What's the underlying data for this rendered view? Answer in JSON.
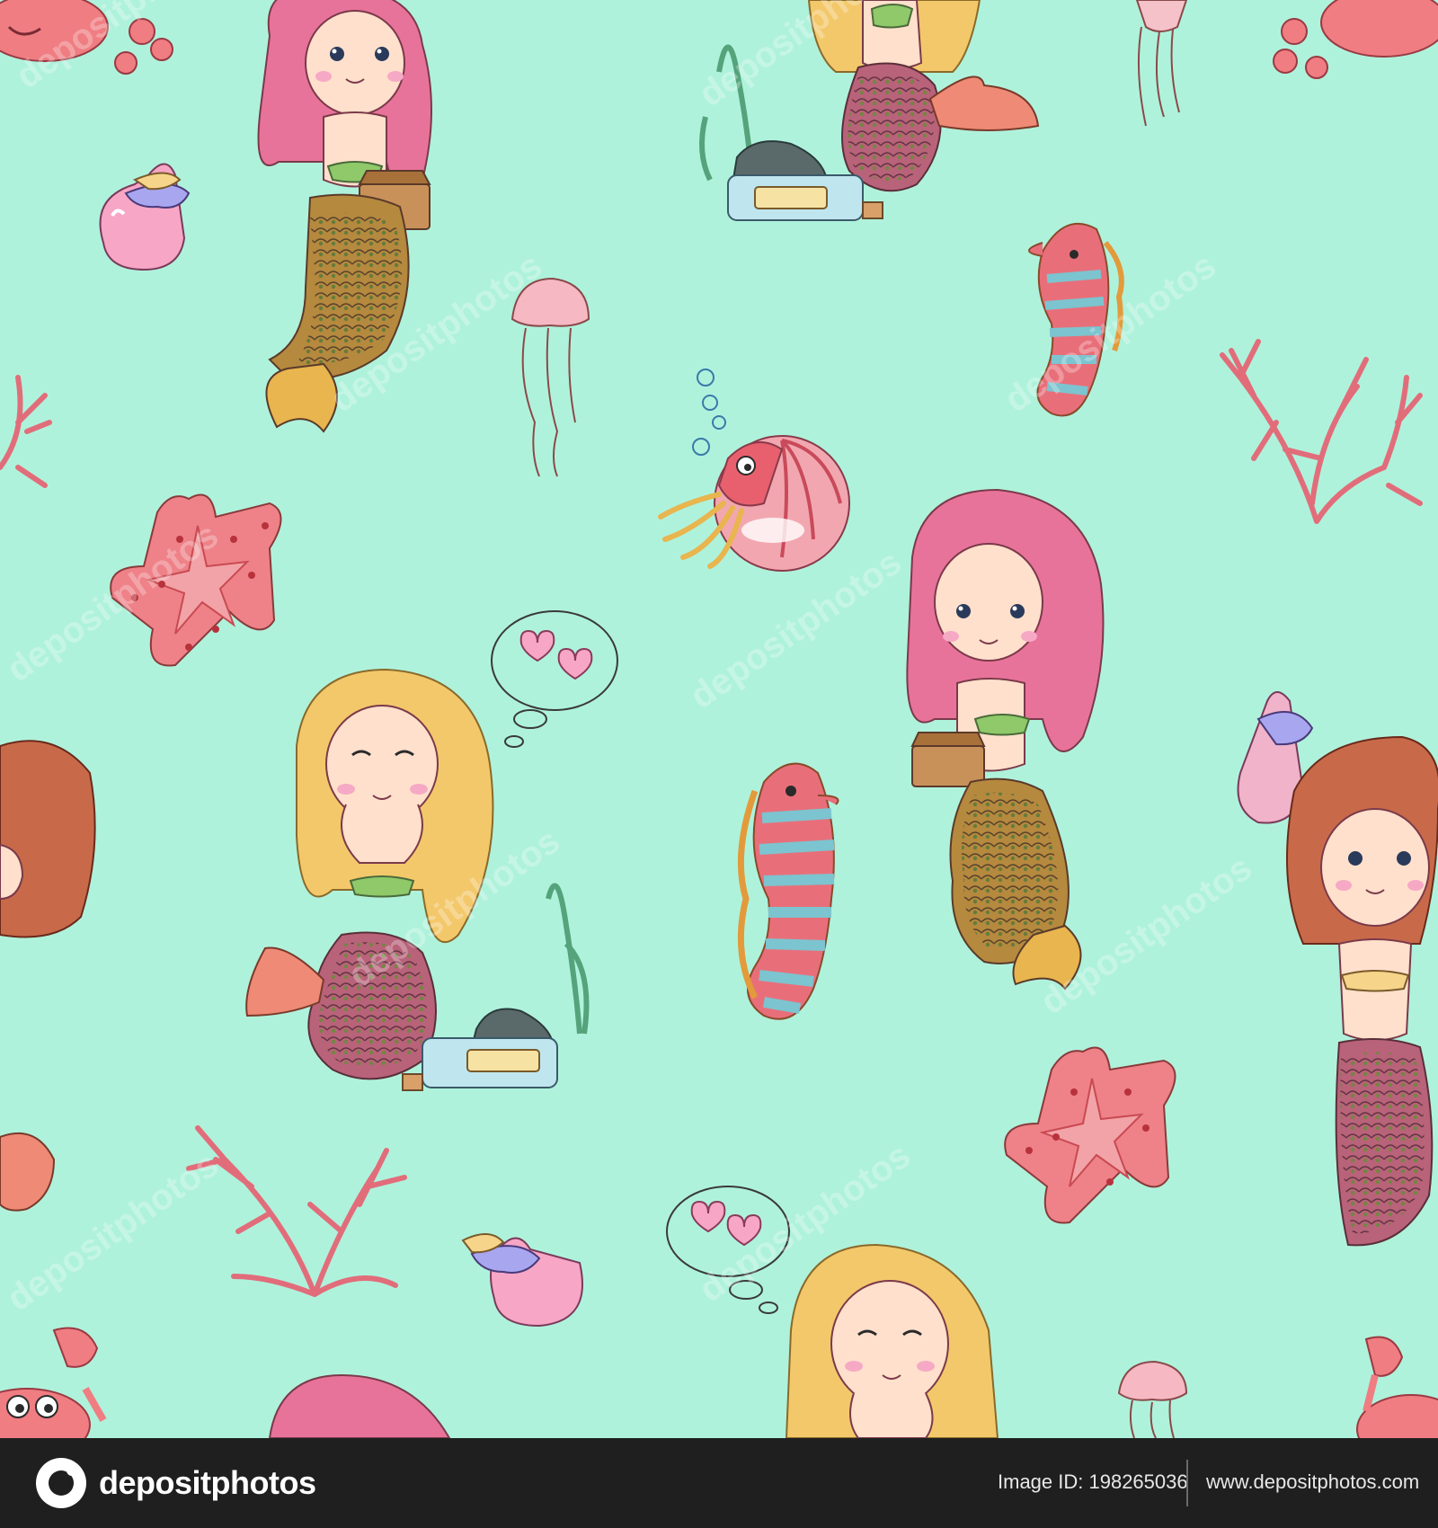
{
  "palette": {
    "background": "#aff2dc",
    "footer": "#1f1f1f",
    "hair_pink": "#e8739a",
    "hair_blonde": "#f3c86b",
    "hair_auburn": "#c86a4a",
    "tail_brown": "#b5893e",
    "tail_pink": "#b8637a",
    "coral": "#e26d7a",
    "starfish": "#e9777f",
    "seahorse_stripe_a": "#e86f7a",
    "seahorse_stripe_b": "#7cc4cf",
    "seaweed": "#55a37b"
  },
  "pattern": {
    "watermark_text": "depositphotos",
    "items": [
      "mermaid-pink-hair-chest",
      "mermaid-blonde-hearts",
      "mermaid-pink-hair-chest-right",
      "mermaid-auburn-shell",
      "mermaid-blonde-top",
      "mermaid-blonde-bottom",
      "seahorse",
      "seahorse-small",
      "starfish",
      "starfish-right",
      "jellyfish",
      "jellyfish-small",
      "jellyfish-top",
      "coral",
      "coral-right",
      "coral-left",
      "seashell",
      "seashell-bottom",
      "nautilus",
      "bottle-message",
      "bottle-message-top",
      "crab",
      "crab-bottom",
      "heart-bubble",
      "heart-bubble-bottom"
    ]
  },
  "footer": {
    "logo_text": "depositphotos",
    "image_id": "Image ID: 198265036",
    "site_url": "www.depositphotos.com"
  }
}
